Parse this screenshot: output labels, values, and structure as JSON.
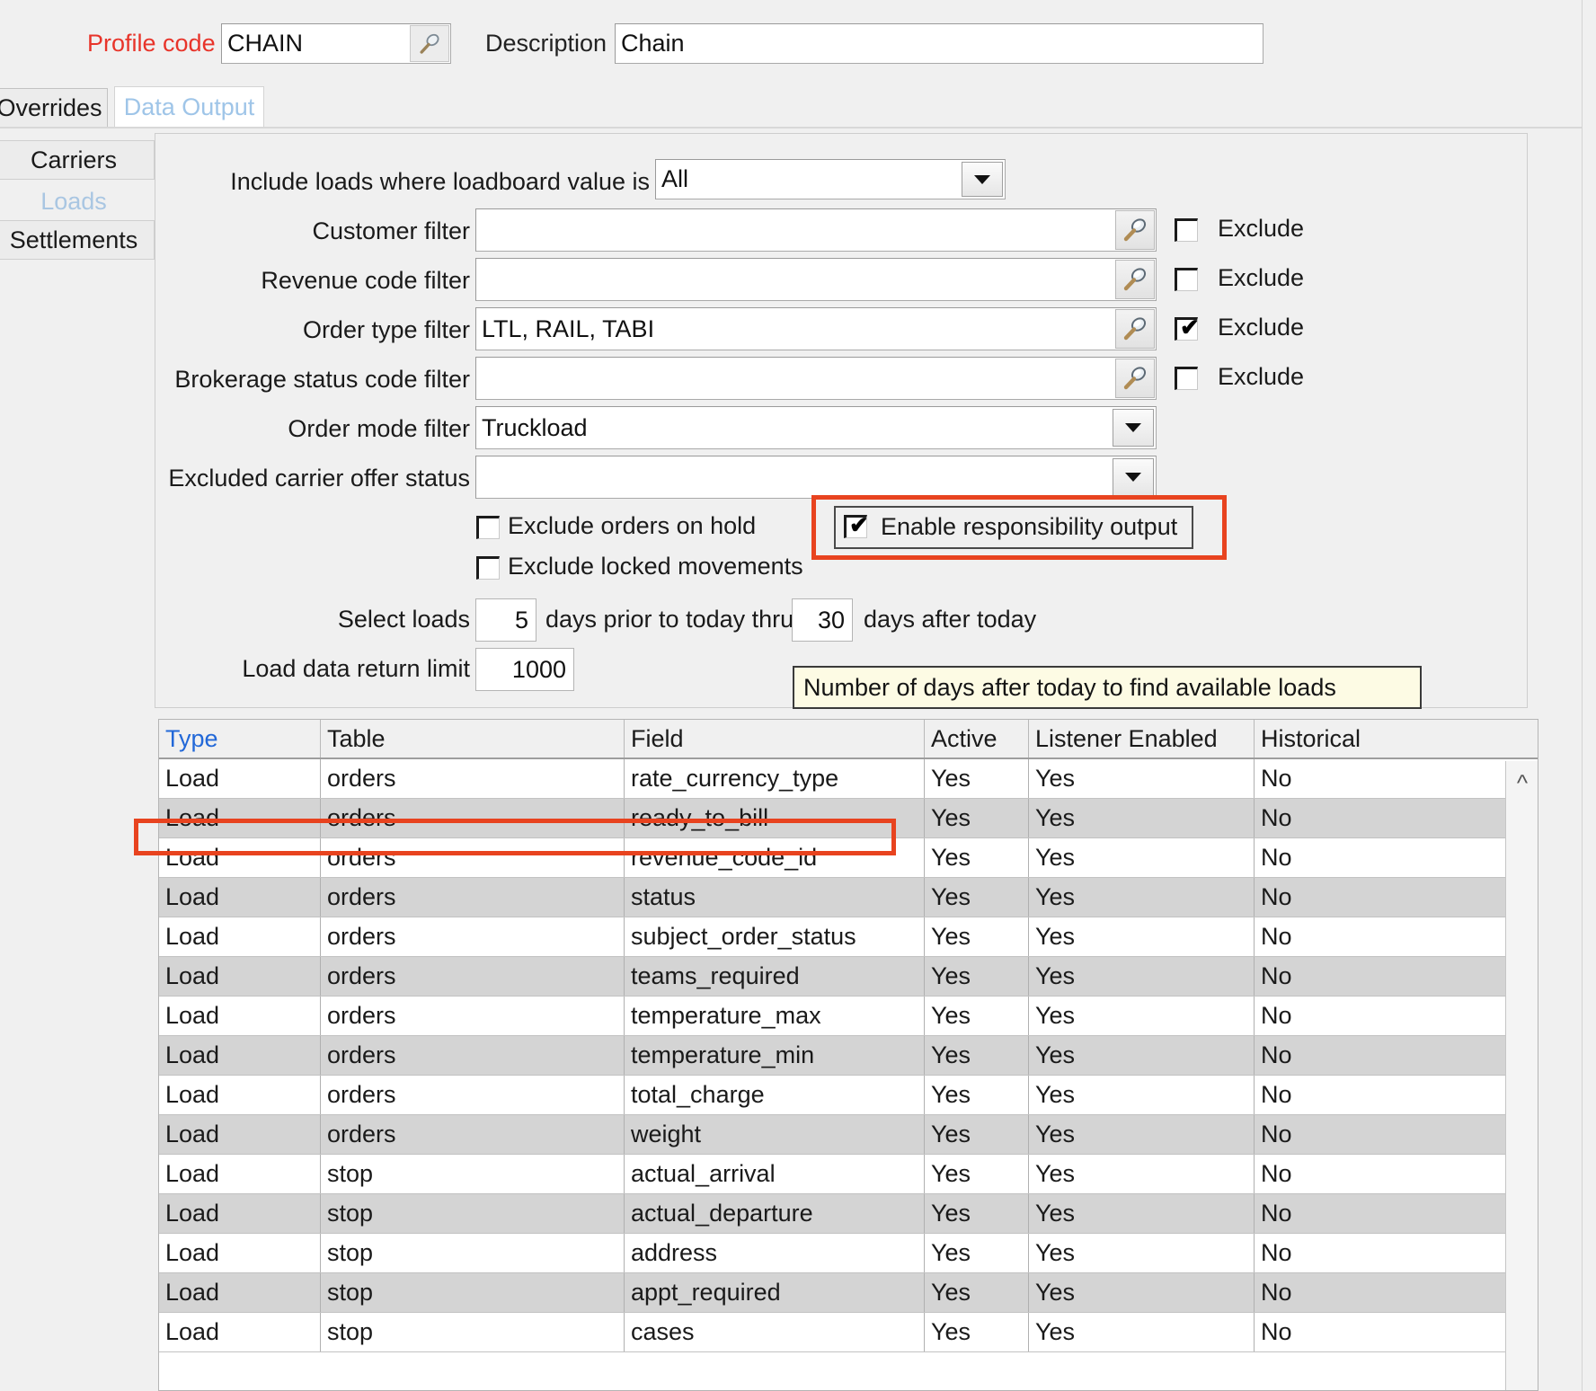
{
  "header": {
    "profile_code_label": "Profile code",
    "profile_code_value": "CHAIN",
    "description_label": "Description",
    "description_value": "Chain",
    "search_icon": "magnifier-icon"
  },
  "tabs": [
    {
      "label": "Overrides",
      "active": false
    },
    {
      "label": "Data Output",
      "active": true
    }
  ],
  "sidebar": {
    "items": [
      {
        "label": "Carriers",
        "selected": false
      },
      {
        "label": "Loads",
        "selected": true
      },
      {
        "label": "Settlements",
        "selected": false
      }
    ]
  },
  "form": {
    "loadboard": {
      "label": "Include loads where loadboard value is",
      "value": "All",
      "options": [
        "All"
      ],
      "icon": "chevron-down-icon"
    },
    "filters": [
      {
        "label": "Customer filter",
        "value": "",
        "exclude_label": "Exclude",
        "exclude_checked": false,
        "icon": "magnifier-icon"
      },
      {
        "label": "Revenue code filter",
        "value": "",
        "exclude_label": "Exclude",
        "exclude_checked": false,
        "icon": "magnifier-icon"
      },
      {
        "label": "Order type filter",
        "value": "LTL, RAIL, TABI",
        "exclude_label": "Exclude",
        "exclude_checked": true,
        "icon": "magnifier-icon"
      },
      {
        "label": "Brokerage status code filter",
        "value": "",
        "exclude_label": "Exclude",
        "exclude_checked": false,
        "icon": "magnifier-icon"
      }
    ],
    "order_mode": {
      "label": "Order mode filter",
      "value": "Truckload",
      "icon": "chevron-down-icon"
    },
    "excluded_carrier_offer_status": {
      "label": "Excluded carrier offer status",
      "value": "",
      "icon": "chevron-down-icon"
    },
    "checkboxes": [
      {
        "label": "Exclude orders on hold",
        "checked": false
      },
      {
        "label": "Exclude locked movements",
        "checked": false
      },
      {
        "label": "Enable responsibility output",
        "checked": true,
        "highlighted": true
      }
    ],
    "select_loads": {
      "prefix": "Select loads",
      "days_prior": "5",
      "middle": "days prior to today thru",
      "days_after": "30",
      "suffix": "days after today"
    },
    "return_limit": {
      "label": "Load data return limit",
      "value": "1000"
    }
  },
  "tooltip": {
    "text": "Number of days after today to find available loads"
  },
  "grid": {
    "columns": [
      {
        "label": "Type",
        "sorted": true
      },
      {
        "label": "Table",
        "sorted": false
      },
      {
        "label": "Field",
        "sorted": false
      },
      {
        "label": "Active",
        "sorted": false
      },
      {
        "label": "Listener Enabled",
        "sorted": false
      },
      {
        "label": "Historical",
        "sorted": false
      }
    ],
    "rows": [
      {
        "type": "Load",
        "table": "orders",
        "field": "rate_currency_type",
        "active": "Yes",
        "listener": "Yes",
        "historical": "No",
        "highlighted": false
      },
      {
        "type": "Load",
        "table": "orders",
        "field": "ready_to_bill",
        "active": "Yes",
        "listener": "Yes",
        "historical": "No",
        "highlighted": false
      },
      {
        "type": "Load",
        "table": "orders",
        "field": "revenue_code_id",
        "active": "Yes",
        "listener": "Yes",
        "historical": "No",
        "highlighted": true
      },
      {
        "type": "Load",
        "table": "orders",
        "field": "status",
        "active": "Yes",
        "listener": "Yes",
        "historical": "No",
        "highlighted": false
      },
      {
        "type": "Load",
        "table": "orders",
        "field": "subject_order_status",
        "active": "Yes",
        "listener": "Yes",
        "historical": "No",
        "highlighted": false
      },
      {
        "type": "Load",
        "table": "orders",
        "field": "teams_required",
        "active": "Yes",
        "listener": "Yes",
        "historical": "No",
        "highlighted": false
      },
      {
        "type": "Load",
        "table": "orders",
        "field": "temperature_max",
        "active": "Yes",
        "listener": "Yes",
        "historical": "No",
        "highlighted": false
      },
      {
        "type": "Load",
        "table": "orders",
        "field": "temperature_min",
        "active": "Yes",
        "listener": "Yes",
        "historical": "No",
        "highlighted": false
      },
      {
        "type": "Load",
        "table": "orders",
        "field": "total_charge",
        "active": "Yes",
        "listener": "Yes",
        "historical": "No",
        "highlighted": false
      },
      {
        "type": "Load",
        "table": "orders",
        "field": "weight",
        "active": "Yes",
        "listener": "Yes",
        "historical": "No",
        "highlighted": false
      },
      {
        "type": "Load",
        "table": "stop",
        "field": "actual_arrival",
        "active": "Yes",
        "listener": "Yes",
        "historical": "No",
        "highlighted": false
      },
      {
        "type": "Load",
        "table": "stop",
        "field": "actual_departure",
        "active": "Yes",
        "listener": "Yes",
        "historical": "No",
        "highlighted": false
      },
      {
        "type": "Load",
        "table": "stop",
        "field": "address",
        "active": "Yes",
        "listener": "Yes",
        "historical": "No",
        "highlighted": false
      },
      {
        "type": "Load",
        "table": "stop",
        "field": "appt_required",
        "active": "Yes",
        "listener": "Yes",
        "historical": "No",
        "highlighted": false
      },
      {
        "type": "Load",
        "table": "stop",
        "field": "cases",
        "active": "Yes",
        "listener": "Yes",
        "historical": "No",
        "highlighted": false
      }
    ],
    "scroll_up_icon": "chevron-up-icon"
  },
  "colors": {
    "required_label": "#e8342a",
    "annotation": "#e8431f",
    "sorted_header": "#2268d8",
    "selected_tab_text": "#9fc5e8",
    "tooltip_bg": "#fdfbe4"
  }
}
